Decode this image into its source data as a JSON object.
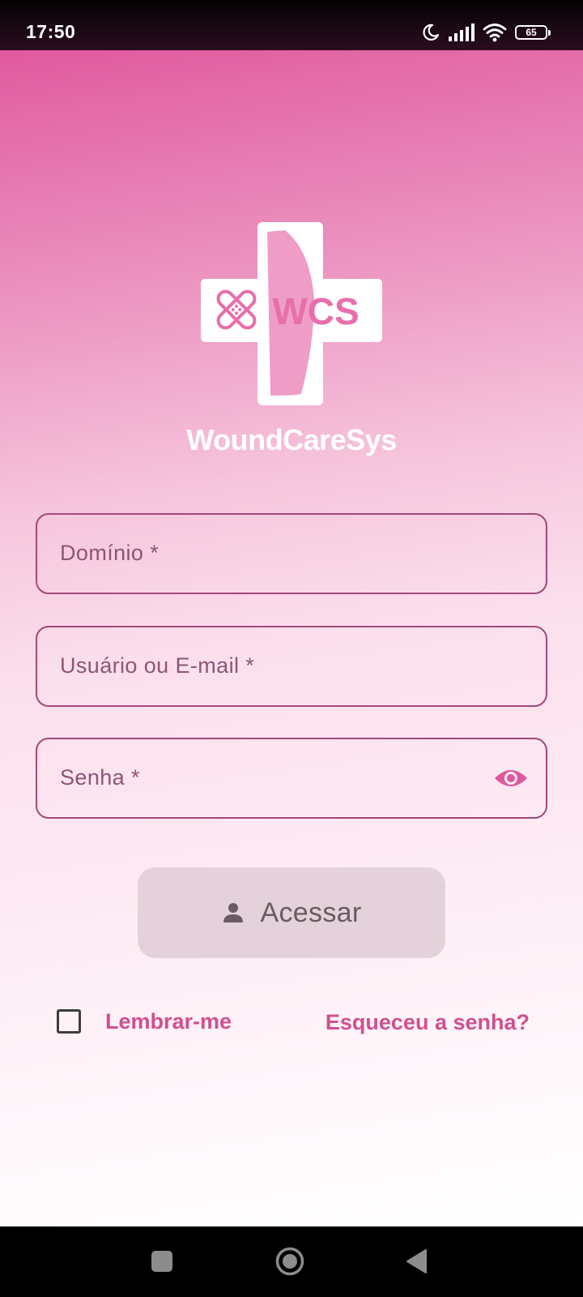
{
  "status_bar": {
    "time": "17:50",
    "battery": "65",
    "icons": [
      "moon-icon",
      "signal-icon",
      "wifi-icon",
      "battery-icon"
    ]
  },
  "logo": {
    "badge_text": "WCS",
    "icon": "bandage-cross-icon"
  },
  "brand": {
    "name": "WoundCareSys"
  },
  "form": {
    "domain_placeholder": "Domínio *",
    "domain_value": "",
    "user_placeholder": "Usuário ou E-mail *",
    "user_value": "",
    "password_placeholder": "Senha *",
    "password_value": "",
    "password_icon": "eye-icon"
  },
  "access_button": {
    "label": "Acessar",
    "icon": "person-icon"
  },
  "remember": {
    "label": "Lembrar-me",
    "checked": false
  },
  "forgot": {
    "label": "Esqueceu a senha?"
  },
  "nav_bar": {
    "icons": [
      "recents-icon",
      "home-icon",
      "back-icon"
    ]
  },
  "colors": {
    "accent": "#d04f90",
    "field_border": "#a2487a",
    "gradient_top": "#e15a9e",
    "button_disabled": "#e4d1d9"
  }
}
